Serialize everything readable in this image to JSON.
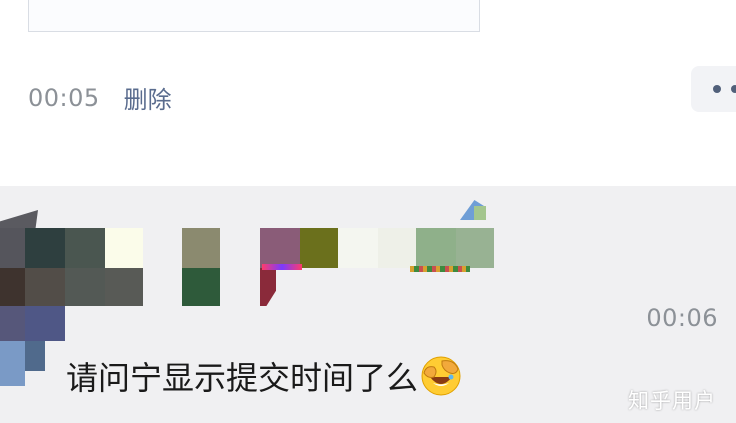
{
  "post": {
    "time": "00:05",
    "delete_label": "删除"
  },
  "reply": {
    "time": "00:06",
    "text": "请问宁显示提交时间了么"
  },
  "watermark": "知乎用户",
  "icons": {
    "more": "more-dots-icon",
    "emoji": "facepalm-laugh-emoji-icon"
  },
  "colors": {
    "link": "#5a6c8e",
    "timestamp": "#8c9197",
    "page_background": "#f0f0f2"
  }
}
